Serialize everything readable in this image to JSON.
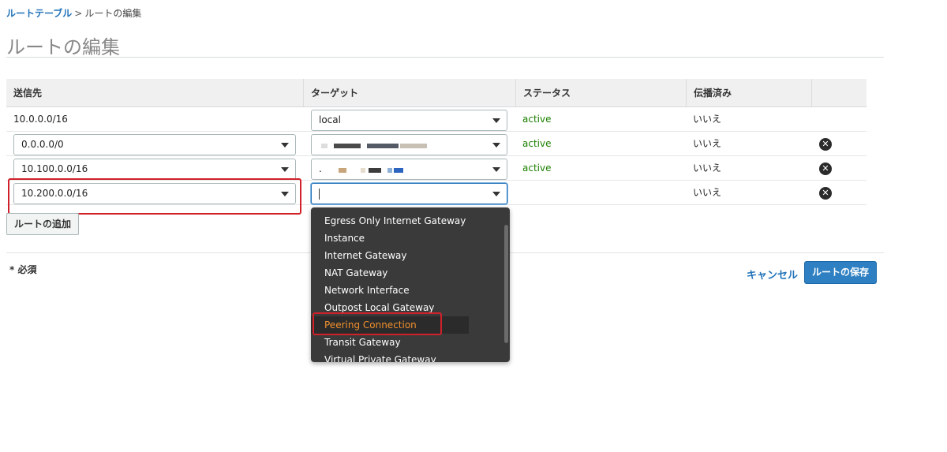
{
  "breadcrumb": {
    "parent": "ルートテーブル",
    "separator": ">",
    "current": "ルートの編集"
  },
  "page_title": "ルートの編集",
  "columns": {
    "destination": "送信先",
    "target": "ターゲット",
    "status": "ステータス",
    "propagated": "伝播済み"
  },
  "rows": [
    {
      "destination": "10.0.0.0/16",
      "target": "local",
      "status": "active",
      "propagated": "いいえ"
    },
    {
      "destination": "0.0.0.0/0",
      "target": "",
      "status": "active",
      "propagated": "いいえ"
    },
    {
      "destination": "10.100.0.0/16",
      "target": ".",
      "status": "active",
      "propagated": "いいえ"
    },
    {
      "destination": "10.200.0.0/16",
      "target": "",
      "status": "",
      "propagated": "いいえ"
    }
  ],
  "add_route_label": "ルートの追加",
  "required_note": "* 必須",
  "cancel_label": "キャンセル",
  "save_label": "ルートの保存",
  "dropdown_options": [
    "Egress Only Internet Gateway",
    "Instance",
    "Internet Gateway",
    "NAT Gateway",
    "Network Interface",
    "Outpost Local Gateway",
    "Peering Connection",
    "Transit Gateway",
    "Virtual Private Gateway"
  ],
  "highlighted_option": "Peering Connection",
  "colors": {
    "link": "#2273b9",
    "status_active": "#1d8102",
    "highlight": "#d0212b",
    "primary_button": "#2f80c2",
    "dropdown_bg": "#3a3a3a",
    "active_option": "#f0902c"
  }
}
